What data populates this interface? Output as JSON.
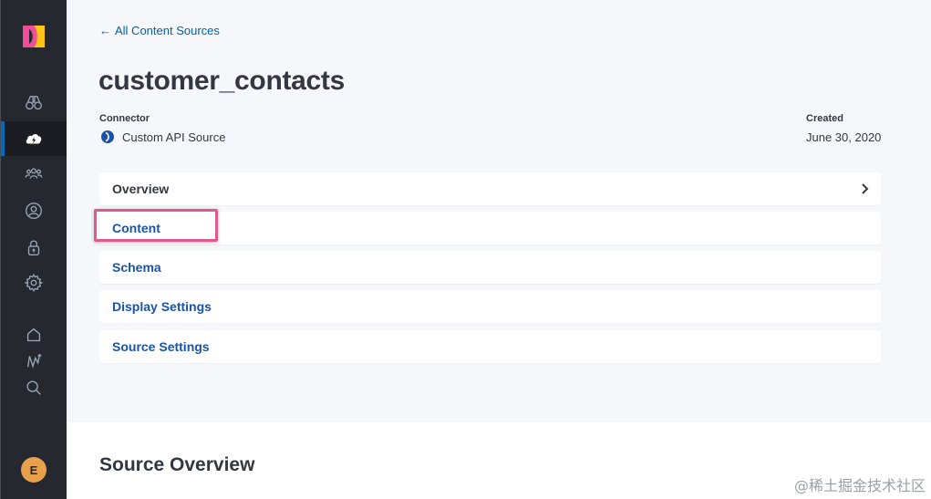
{
  "sidebar": {
    "logo": "brand-logo",
    "nav_items": [
      {
        "icon": "binoculars-icon",
        "active": false
      },
      {
        "icon": "cloud-lightning-icon",
        "active": true
      },
      {
        "icon": "users-group-icon",
        "active": false
      },
      {
        "icon": "user-circle-icon",
        "active": false
      },
      {
        "icon": "lock-icon",
        "active": false
      },
      {
        "icon": "gear-icon",
        "active": false
      },
      {
        "icon": "home-icon",
        "active": false
      },
      {
        "icon": "workflow-icon",
        "active": false
      },
      {
        "icon": "search-icon",
        "active": false
      }
    ],
    "avatar_initial": "E"
  },
  "header": {
    "back_link": "All Content Sources",
    "title": "customer_contacts",
    "connector_label": "Connector",
    "connector_value": "Custom API Source",
    "created_label": "Created",
    "created_value": "June 30, 2020"
  },
  "menu": [
    {
      "label": "Overview",
      "has_chevron": true
    },
    {
      "label": "Content",
      "highlighted": true
    },
    {
      "label": "Schema"
    },
    {
      "label": "Display Settings"
    },
    {
      "label": "Source Settings"
    }
  ],
  "section": {
    "title": "Source Overview"
  },
  "watermark": "@稀土掘金技术社区",
  "colors": {
    "sidebar_bg": "#25282f",
    "active_indicator": "#006bb8",
    "link": "#0061a6",
    "menu_link": "#1a54a8",
    "highlight_border": "#e05a8f",
    "avatar_bg": "#e7a14b"
  }
}
